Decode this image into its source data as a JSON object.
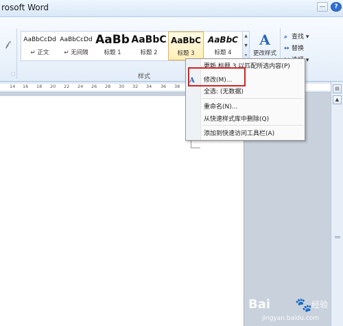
{
  "window": {
    "title": "rosoft Word",
    "minimize": "—",
    "help": "?"
  },
  "ribbon": {
    "styles_gallery": [
      {
        "sample": "AaBbCcDd",
        "name": "↵ 正文"
      },
      {
        "sample": "AaBbCcDd",
        "name": "↵ 无间隔"
      },
      {
        "sample": "AaBb",
        "name": "标题 1"
      },
      {
        "sample": "AaBbC",
        "name": "标题 2"
      },
      {
        "sample": "AaBbC",
        "name": "标题 3"
      },
      {
        "sample": "AaBbC",
        "name": "标题 4"
      }
    ],
    "styles_group_label": "样式",
    "change_styles_label": "更改样式",
    "editing": {
      "find": "查找",
      "replace": "替换",
      "select": "选择"
    }
  },
  "ruler": {
    "ticks": [
      "14",
      "16",
      "18",
      "20",
      "22",
      "24",
      "26",
      "28",
      "30",
      "32",
      "34",
      "36",
      "38"
    ]
  },
  "context_menu": {
    "items": [
      "更新 标题 3 以匹配所选内容(P)",
      "修改(M)...",
      "全选: (无数据)",
      "重命名(N)...",
      "从快速样式库中删除(Q)",
      "添加到快速访问工具栏(A)"
    ]
  },
  "watermark": {
    "brand": "Bai",
    "brand_suffix": "经验",
    "url": "jingyan.baidu.com"
  },
  "colors": {
    "highlight_box": "#d62020",
    "selected_style": "#e6b24c",
    "accent": "#2c64b8"
  }
}
